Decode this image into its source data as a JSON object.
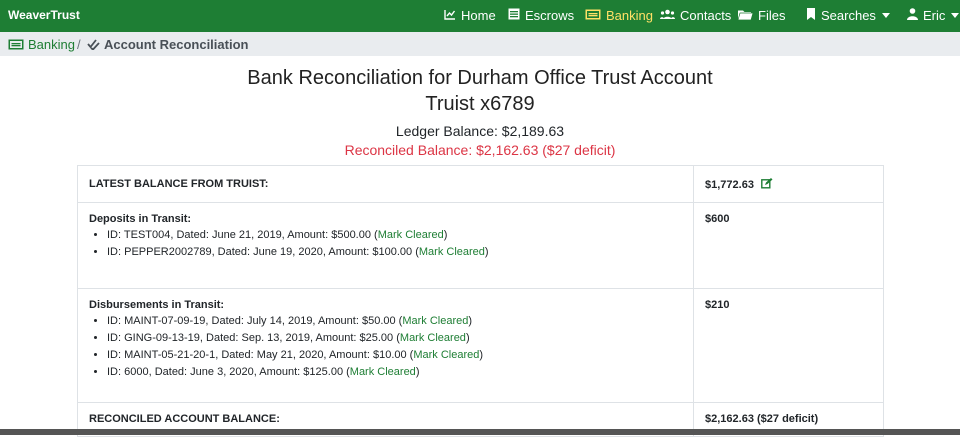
{
  "nav": {
    "brand": "WeaverTrust",
    "items": [
      {
        "label": "Home",
        "icon": "chart-line-icon"
      },
      {
        "label": "Escrows",
        "icon": "list-icon"
      },
      {
        "label": "Banking",
        "icon": "money-bill-icon"
      },
      {
        "label": "Contacts",
        "icon": "users-icon"
      },
      {
        "label": "Files",
        "icon": "folder-icon"
      },
      {
        "label": "Searches",
        "icon": "bookmark-icon"
      },
      {
        "label": "Eric",
        "icon": "user-icon"
      }
    ]
  },
  "breadcrumb": {
    "banking": "Banking",
    "separator": "/",
    "current": "Account Reconciliation"
  },
  "header": {
    "title_line1": "Bank Reconciliation for Durham Office Trust Account",
    "title_line2": "Truist x6789",
    "ledger_balance": "Ledger Balance: $2,189.63",
    "reconciled_balance": "Reconciled Balance: $2,162.63 ($27 deficit)"
  },
  "table": {
    "latest_label": "LATEST BALANCE FROM TRUIST:",
    "latest_amount": "$1,772.63",
    "deposits_label": "Deposits in Transit:",
    "deposits_amount": "$600",
    "deposits": [
      {
        "text": "ID: TEST004, Dated: June 21, 2019, Amount: $500.00 (",
        "action": "Mark Cleared",
        "close": ")"
      },
      {
        "text": "ID: PEPPER2002789, Dated: June 19, 2020, Amount: $100.00 (",
        "action": "Mark Cleared",
        "close": ")"
      }
    ],
    "disb_label": "Disbursements in Transit:",
    "disb_amount": "$210",
    "disbursements": [
      {
        "text": "ID: MAINT-07-09-19, Dated: July 14, 2019, Amount: $50.00 (",
        "action": "Mark Cleared",
        "close": ")"
      },
      {
        "text": "ID: GING-09-13-19, Dated: Sep. 13, 2019, Amount: $25.00 (",
        "action": "Mark Cleared",
        "close": ")"
      },
      {
        "text": "ID: MAINT-05-21-20-1, Dated: May 21, 2020, Amount: $10.00 (",
        "action": "Mark Cleared",
        "close": ")"
      },
      {
        "text": "ID: 6000, Dated: June 3, 2020, Amount: $125.00 (",
        "action": "Mark Cleared",
        "close": ")"
      }
    ],
    "reconciled_label": "RECONCILED ACCOUNT BALANCE:",
    "reconciled_amount": "$2,162.63 ($27 deficit)"
  },
  "colors": {
    "navbar": "#1e7e34",
    "active": "#ffe066",
    "link": "#1e7e34",
    "deficit": "#dc3545"
  }
}
